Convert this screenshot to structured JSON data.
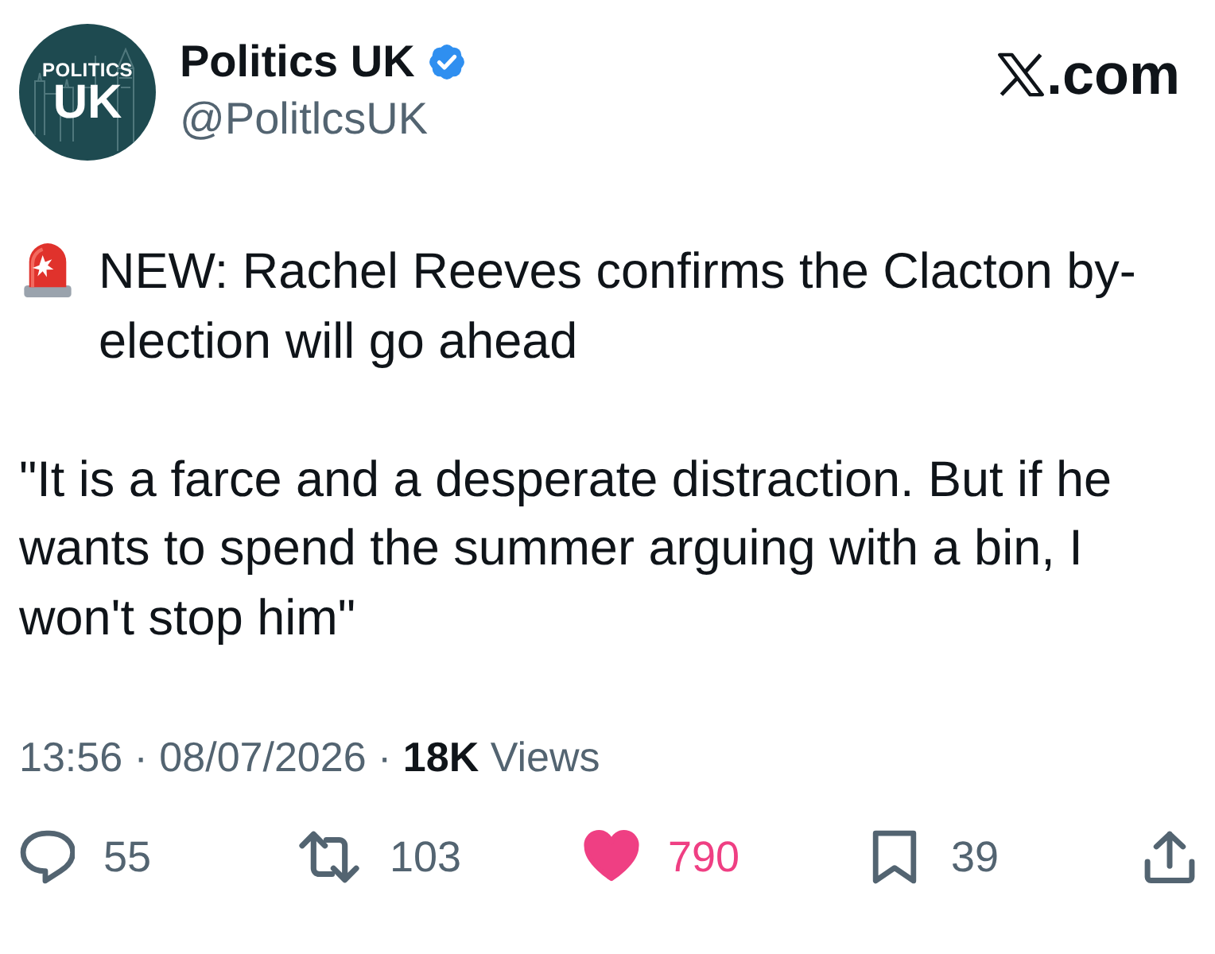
{
  "header": {
    "avatar": {
      "lines": [
        "POLITICS",
        "UK"
      ]
    },
    "name": "Politics UK",
    "verified": true,
    "handle": "@PolitlcsUK",
    "source": ".com"
  },
  "body": [
    {
      "kind": "alert",
      "text": "NEW: Rachel Reeves confirms the Clacton by-election will go ahead"
    },
    {
      "kind": "plain",
      "text": "\"It is a farce and a desperate distraction. But if he wants to spend the summer arguing with a bin, I won't stop him\""
    }
  ],
  "meta": "13:56 · 08/07/2026 · **18K** Views",
  "actions": [
    {
      "kind": "reply",
      "count": "55",
      "selected": false
    },
    {
      "kind": "repost",
      "count": "103",
      "selected": false
    },
    {
      "kind": "like",
      "count": "790",
      "selected": true
    },
    {
      "kind": "bookmark",
      "count": "39",
      "selected": false
    },
    {
      "kind": "share",
      "selected": false
    }
  ]
}
